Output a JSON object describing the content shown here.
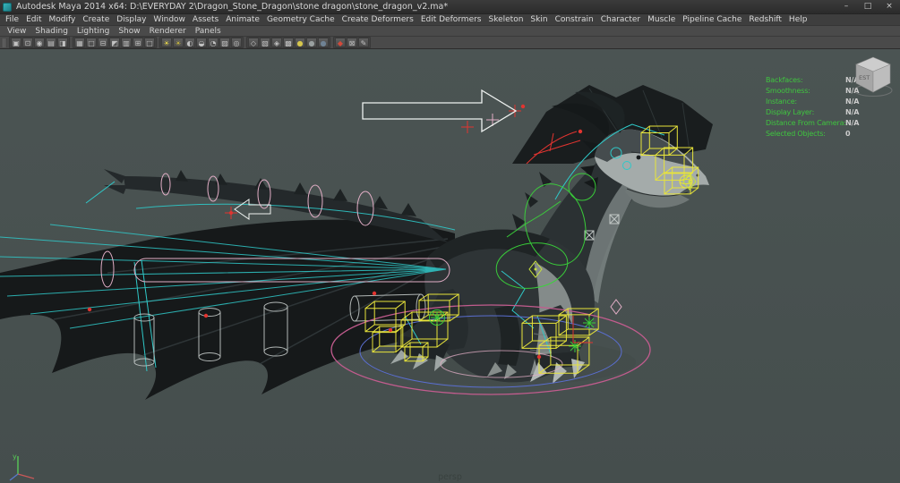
{
  "window": {
    "title": "Autodesk Maya 2014 x64: D:\\EVERYDAY 2\\Dragon_Stone_Dragon\\stone dragon\\stone_dragon_v2.ma*",
    "controls": {
      "minimize_icon": "–",
      "maximize_icon": "□",
      "close_icon": "×"
    }
  },
  "menubar": {
    "items": [
      "File",
      "Edit",
      "Modify",
      "Create",
      "Display",
      "Window",
      "Assets",
      "Animate",
      "Geometry Cache",
      "Create Deformers",
      "Edit Deformers",
      "Skeleton",
      "Skin",
      "Constrain",
      "Character",
      "Muscle",
      "Pipeline Cache",
      "Redshift",
      "Help"
    ]
  },
  "panel_menubar": {
    "items": [
      "View",
      "Shading",
      "Lighting",
      "Show",
      "Renderer",
      "Panels"
    ]
  },
  "panel_toolbar": {
    "groups": [
      [
        {
          "name": "select-camera-icon",
          "glyph": "▣"
        },
        {
          "name": "lock-camera-icon",
          "glyph": "⊡"
        },
        {
          "name": "camera-attributes-icon",
          "glyph": "◉"
        },
        {
          "name": "bookmark-icon",
          "glyph": "▤"
        },
        {
          "name": "image-plane-icon",
          "glyph": "◨"
        }
      ],
      [
        {
          "name": "grid-icon",
          "glyph": "▦"
        },
        {
          "name": "film-gate-icon",
          "glyph": "□"
        },
        {
          "name": "resolution-gate-icon",
          "glyph": "⊟"
        },
        {
          "name": "gate-mask-icon",
          "glyph": "◩"
        },
        {
          "name": "field-chart-icon",
          "glyph": "▥"
        },
        {
          "name": "safe-action-icon",
          "glyph": "⊞"
        },
        {
          "name": "safe-title-icon",
          "glyph": "□"
        }
      ],
      [
        {
          "name": "default-lighting-icon",
          "glyph": "☀",
          "color": "#e3d24a"
        },
        {
          "name": "all-lights-icon",
          "glyph": "☀",
          "color": "#c2b23e"
        },
        {
          "name": "shadows-icon",
          "glyph": "◐"
        },
        {
          "name": "occlusion-icon",
          "glyph": "◒"
        },
        {
          "name": "motion-blur-icon",
          "glyph": "◔"
        },
        {
          "name": "multisample-icon",
          "glyph": "▨"
        },
        {
          "name": "depth-of-field-icon",
          "glyph": "◎"
        }
      ],
      [
        {
          "name": "isolate-select-icon",
          "glyph": "◇"
        },
        {
          "name": "xray-icon",
          "glyph": "▧"
        },
        {
          "name": "xray-joints-icon",
          "glyph": "◈"
        },
        {
          "name": "wireframe-on-shaded-icon",
          "glyph": "▩"
        },
        {
          "name": "textured-icon",
          "glyph": "●",
          "color": "#d6c64c"
        },
        {
          "name": "smooth-shaded-icon",
          "glyph": "●",
          "color": "#9aa0a0"
        },
        {
          "name": "default-material-icon",
          "glyph": "●",
          "color": "#6f8294"
        }
      ],
      [
        {
          "name": "plugin-icon",
          "glyph": "◆",
          "color": "#d2493a"
        },
        {
          "name": "snapshot-icon",
          "glyph": "⊠"
        },
        {
          "name": "grease-pencil-icon",
          "glyph": "✎"
        }
      ]
    ]
  },
  "hud": {
    "entries": [
      {
        "label": "Backfaces:",
        "value": "N/A"
      },
      {
        "label": "Smoothness:",
        "value": "N/A"
      },
      {
        "label": "Instance:",
        "value": "N/A"
      },
      {
        "label": "Display Layer:",
        "value": "N/A"
      },
      {
        "label": "Distance From Camera:",
        "value": "N/A"
      },
      {
        "label": "Selected Objects:",
        "value": "0"
      }
    ]
  },
  "viewport": {
    "camera_label": "persp",
    "viewcube_label": "EST",
    "axis_y_label": "y"
  },
  "colors": {
    "viewport_bg": "#4b5453",
    "viewport_bg_bottom": "#454e4d",
    "hud_label": "#3fc43f",
    "hud_value": "#cccccc",
    "rig_yellow": "#e8e43a",
    "rig_yellowgreen": "#c8e23c",
    "rig_cyan": "#2fc8c8",
    "rig_green": "#3ad43a",
    "rig_red": "#e23430",
    "rig_pink": "#e2aec6",
    "rig_rose": "#c25c8e",
    "rig_blue": "#5a6ed0",
    "rig_gray": "#c2c8c6",
    "rig_white": "#eef2f0",
    "axis_y": "#58c858",
    "axis_x": "#c85858",
    "axis_z": "#5878c8"
  }
}
